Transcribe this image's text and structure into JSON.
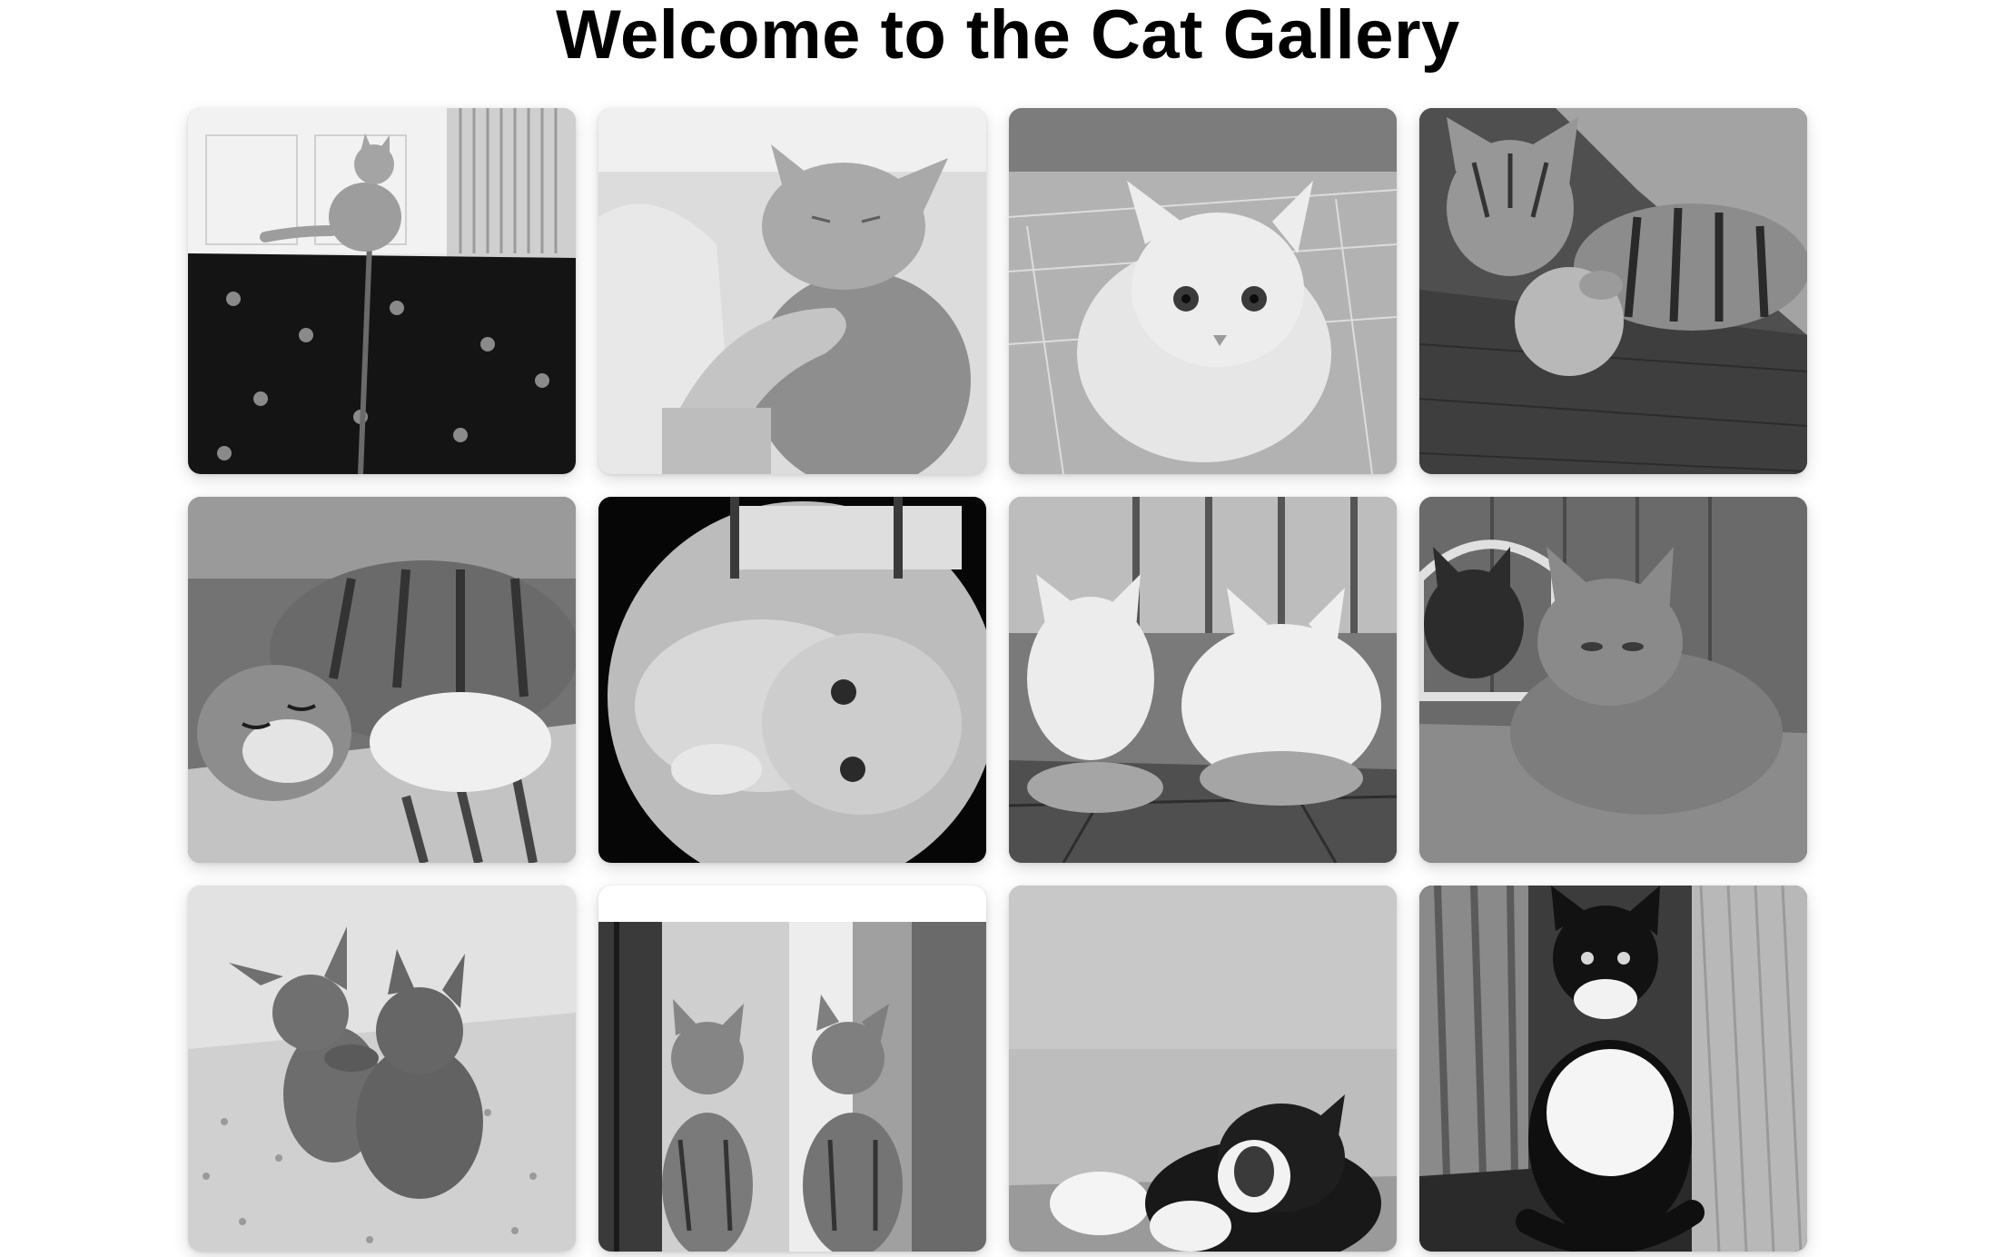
{
  "page": {
    "title": "Welcome to the Cat Gallery"
  },
  "gallery": {
    "images": [
      {
        "alt": "",
        "scene": "cat-on-leash-by-door",
        "tone": "#9a9a9a"
      },
      {
        "alt": "",
        "scene": "cat-chin-scratch",
        "tone": "#bdbdbd"
      },
      {
        "alt": "",
        "scene": "fluffy-white-cat-market",
        "tone": "#c9c9c9"
      },
      {
        "alt": "",
        "scene": "tabby-with-ball",
        "tone": "#6d6d6d"
      },
      {
        "alt": "",
        "scene": "sleeping-tabby",
        "tone": "#8a8a8a"
      },
      {
        "alt": "",
        "scene": "fisheye-persian",
        "tone": "#a8a8a8"
      },
      {
        "alt": "",
        "scene": "two-white-cats-bowls",
        "tone": "#7d7d7d"
      },
      {
        "alt": "",
        "scene": "tortoiseshell-on-bed",
        "tone": "#7a7a7a"
      },
      {
        "alt": "",
        "scene": "sphynx-kittens-hug",
        "tone": "#d6d6d6"
      },
      {
        "alt": "",
        "scene": "two-tabby-kittens-window",
        "tone": "#a3a3a3"
      },
      {
        "alt": "",
        "scene": "tuxedo-cat-yawning",
        "tone": "#b4b4b4"
      },
      {
        "alt": "",
        "scene": "tuxedo-cat-sitting",
        "tone": "#5d5d5d"
      }
    ]
  }
}
